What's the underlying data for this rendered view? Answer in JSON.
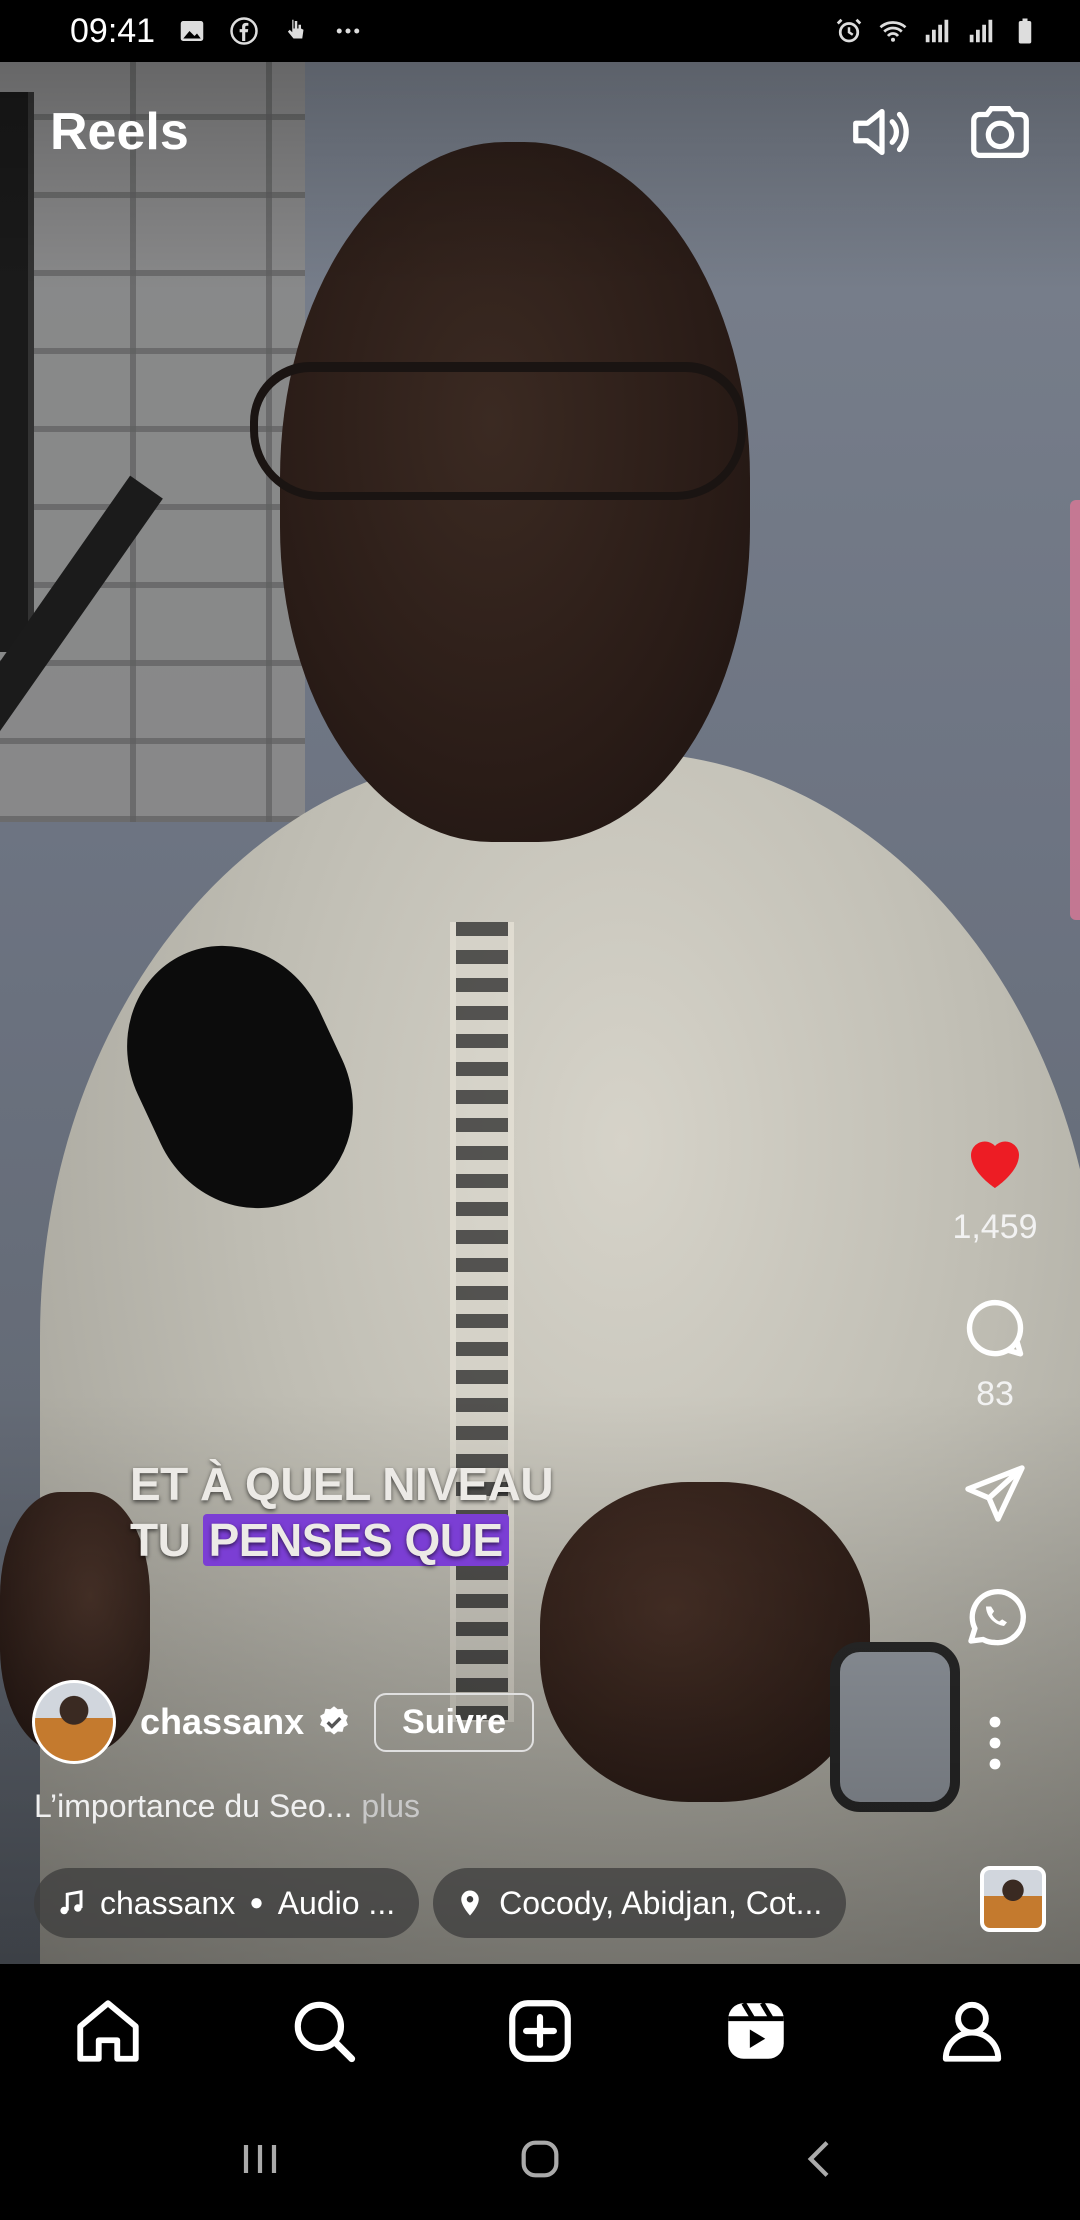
{
  "status_bar": {
    "time": "09:41",
    "left_icons": [
      "image-icon",
      "facebook-icon",
      "hand-icon",
      "more-dots-icon"
    ],
    "right_icons": [
      "alarm-icon",
      "wifi-icon",
      "signal-icon",
      "signal-icon",
      "battery-icon"
    ]
  },
  "header": {
    "title": "Reels",
    "sound_icon": "volume-icon",
    "camera_icon": "camera-icon"
  },
  "video": {
    "caption_line1": "ET À QUEL NIVEAU",
    "caption_line2_plain": "TU ",
    "caption_line2_highlight": "PENSES QUE",
    "highlight_color": "#7b3ed4"
  },
  "actions": {
    "likes": "1,459",
    "comments": "83",
    "like_color": "#ed1c24"
  },
  "post": {
    "author": "chassanx",
    "follow_label": "Suivre",
    "description": "L’importance du Seo...",
    "more_label": " plus",
    "audio_author": "chassanx",
    "audio_label": "Audio ...",
    "location": "Cocody, Abidjan, Cot..."
  },
  "bottom_nav": [
    "home-icon",
    "search-icon",
    "create-icon",
    "reels-icon",
    "profile-icon"
  ],
  "system_nav": [
    "recents-icon",
    "home-button-icon",
    "back-icon"
  ]
}
